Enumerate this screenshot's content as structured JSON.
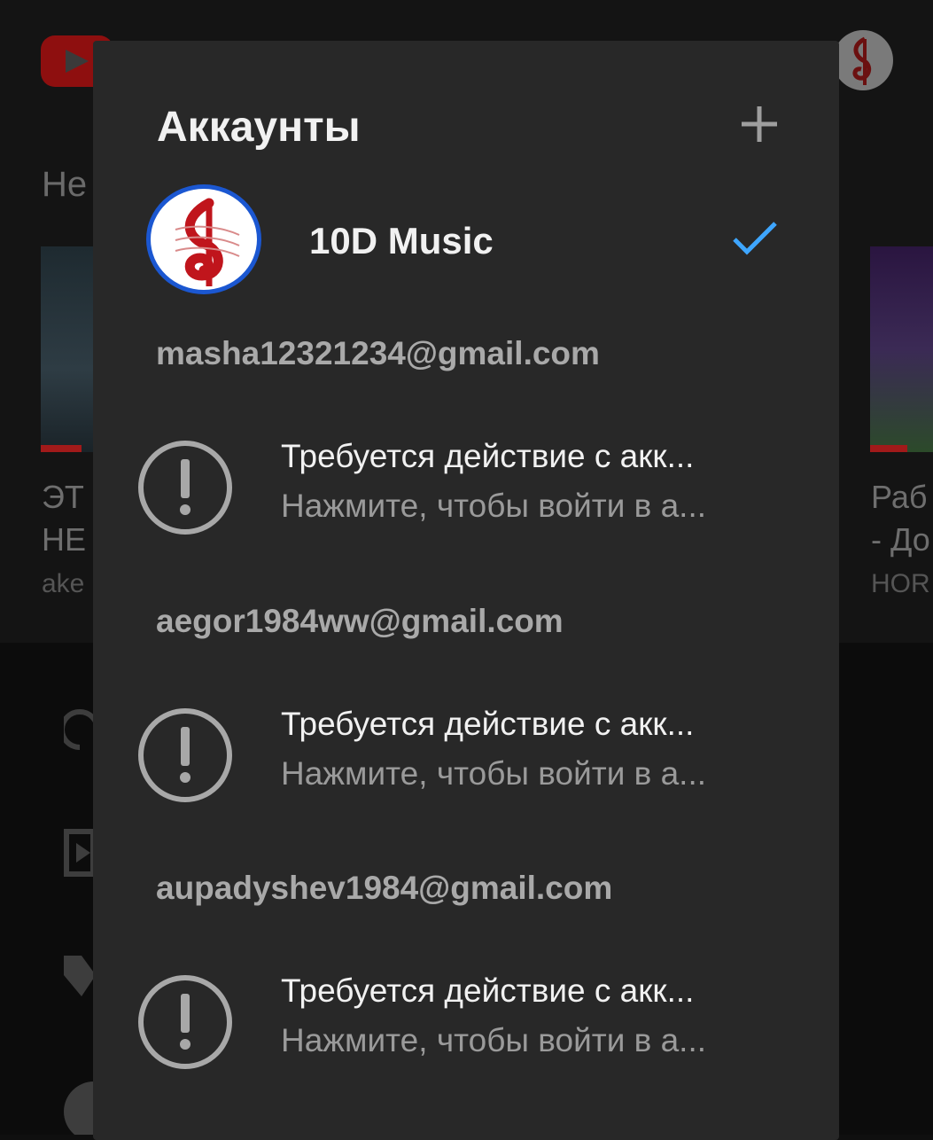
{
  "background": {
    "heading": "Не",
    "video_left": {
      "line1": "ЭТ",
      "line2": "НЕ",
      "channel": "ake"
    },
    "video_right": {
      "line1": "Раб",
      "line2": "- До",
      "channel": "HOR"
    }
  },
  "dialog": {
    "title": "Аккаунты",
    "current_account": {
      "name": "10D Music"
    },
    "accounts": [
      {
        "email": "masha12321234@gmail.com",
        "title": "Требуется действие с акк...",
        "subtitle": "Нажмите, чтобы войти в а..."
      },
      {
        "email": "aegor1984ww@gmail.com",
        "title": "Требуется действие с акк...",
        "subtitle": "Нажмите, чтобы войти в а..."
      },
      {
        "email": "aupadyshev1984@gmail.com",
        "title": "Требуется действие с акк...",
        "subtitle": "Нажмите, чтобы войти в а..."
      }
    ]
  },
  "icons": {
    "add": "plus-icon",
    "check": "checkmark-icon",
    "alert": "alert-circle-icon"
  },
  "colors": {
    "dialog_bg": "#282828",
    "check_blue": "#3ea6ff",
    "avatar_ring": "#1b57d1",
    "youtube_red": "#8e0f0f"
  }
}
